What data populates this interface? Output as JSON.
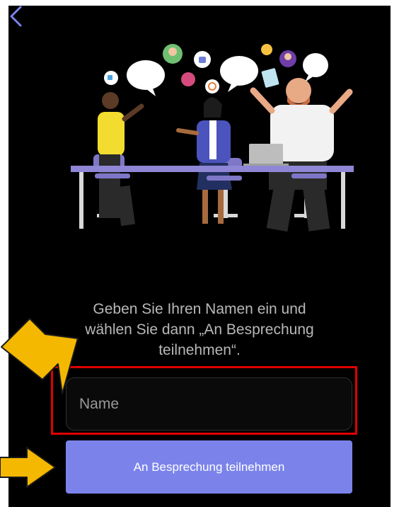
{
  "instruction": {
    "text": "Geben Sie Ihren Namen ein und\nwählen Sie dann „An Besprechung\nteilnehmen“."
  },
  "name_field": {
    "placeholder": "Name",
    "value": ""
  },
  "join_button": {
    "label": "An Besprechung teilnehmen"
  },
  "colors": {
    "background": "#000000",
    "primary": "#7b83eb",
    "highlight_border": "#e00000",
    "annotation_arrow": "#f5b800",
    "back_icon": "#7b83eb"
  },
  "icons": {
    "back": "chevron-left-icon",
    "annotation": "arrow-icon"
  }
}
